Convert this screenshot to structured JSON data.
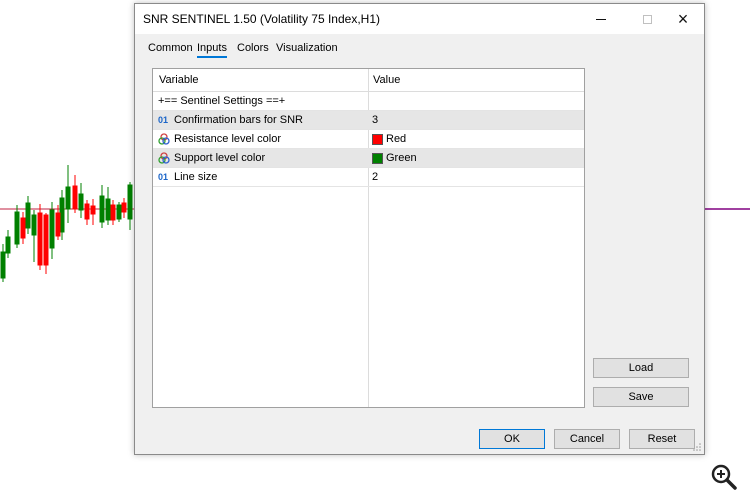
{
  "dialog": {
    "title": "SNR SENTINEL 1.50 (Volatility 75 Index,H1)",
    "window_controls": {
      "minimize": "minimize-icon",
      "maximize": "maximize-icon",
      "close": "×"
    }
  },
  "tabs": [
    {
      "label": "Common",
      "active": false
    },
    {
      "label": "Inputs",
      "active": true
    },
    {
      "label": "Colors",
      "active": false
    },
    {
      "label": "Visualization",
      "active": false
    }
  ],
  "grid": {
    "headers": {
      "variable": "Variable",
      "value": "Value"
    },
    "rows": [
      {
        "icon": "none",
        "variable": "+== Sentinel Settings ==+",
        "value": ""
      },
      {
        "icon": "int-icon",
        "icon_text": "01",
        "variable": "Confirmation bars for SNR",
        "value": "3"
      },
      {
        "icon": "color-icon",
        "variable": "Resistance level color",
        "value": "Red",
        "swatch": "#ff0000"
      },
      {
        "icon": "color-icon",
        "variable": "Support level color",
        "value": "Green",
        "swatch": "#008000"
      },
      {
        "icon": "int-icon",
        "icon_text": "01",
        "variable": "Line size",
        "value": "2"
      }
    ]
  },
  "buttons": {
    "load": "Load",
    "save": "Save",
    "ok": "OK",
    "cancel": "Cancel",
    "reset": "Reset"
  },
  "colors": {
    "accent": "#0078d7",
    "bull_candle": "#008000",
    "bear_candle": "#ff0000",
    "level_line": "#800080"
  }
}
